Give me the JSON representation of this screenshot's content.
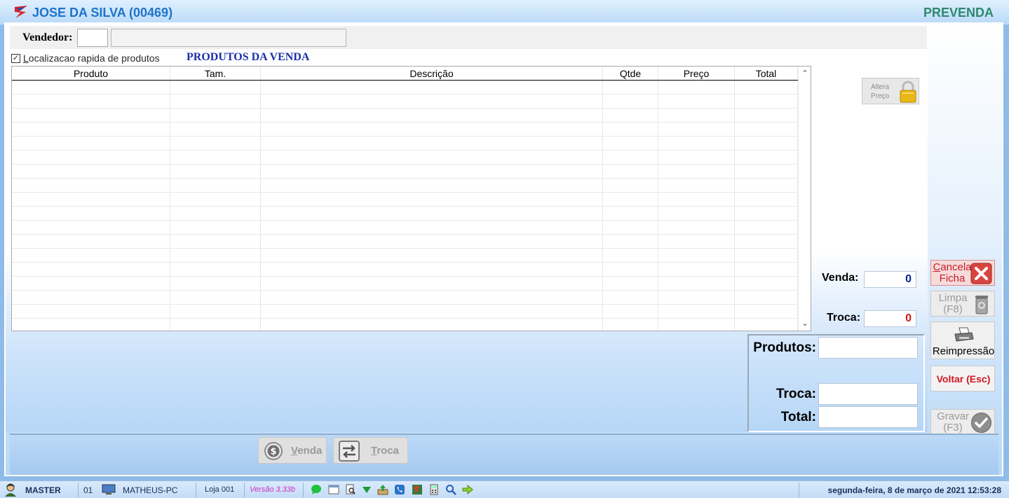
{
  "window": {
    "title": "JOSE DA SILVA (00469)",
    "mode": "PREVENDA"
  },
  "vendedor": {
    "label": "Vendedor:",
    "code": "",
    "name": ""
  },
  "quick_find": {
    "checked": true,
    "label": "Localizacao rapida de produtos"
  },
  "products_section_title": "PRODUTOS DA VENDA",
  "grid": {
    "columns": [
      "Produto",
      "Tam.",
      "Descrição",
      "Qtde",
      "Preço",
      "Total"
    ],
    "rows": []
  },
  "altera_preco": {
    "line1": "Altera",
    "line2": "Preço"
  },
  "counters": {
    "venda_label": "Venda:",
    "venda_value": "0",
    "troca_label": "Troca:",
    "troca_value": "0"
  },
  "totals": {
    "produtos_label": "Produtos:",
    "troca_label": "Troca:",
    "total_label": "Total:"
  },
  "buttons": {
    "cancela_line1": "Cancela",
    "cancela_line2": "Ficha",
    "limpa_line1": "Limpa",
    "limpa_line2": "(F8)",
    "reimpressao": "Reimpressão",
    "voltar": "Voltar (Esc)",
    "gravar_line1": "Gravar",
    "gravar_line2": "(F3)",
    "venda": "Venda",
    "troca": "Troca"
  },
  "statusbar": {
    "user": "MASTER",
    "terminal": "01",
    "computer": "MATHEUS-PC",
    "store": "Loja 001",
    "version": "Versão 3.33b",
    "datetime": "segunda-feira, 8 de março de 2021 12:53:28"
  },
  "colors": {
    "title_blue": "#1e73c8",
    "mode_green": "#2c8a6e",
    "section_blue": "#1a2fa8",
    "counter_venda": "#0a1f8c",
    "counter_troca": "#d4161e",
    "cancel_red": "#c4202a",
    "version_magenta": "#d030c0"
  },
  "status_icons": [
    "chat-icon",
    "window-icon",
    "search-doc-icon",
    "down-arrow-icon",
    "upload-icon",
    "phone-icon",
    "app-icon",
    "calculator-icon",
    "magnifier-icon",
    "forward-arrow-icon"
  ]
}
